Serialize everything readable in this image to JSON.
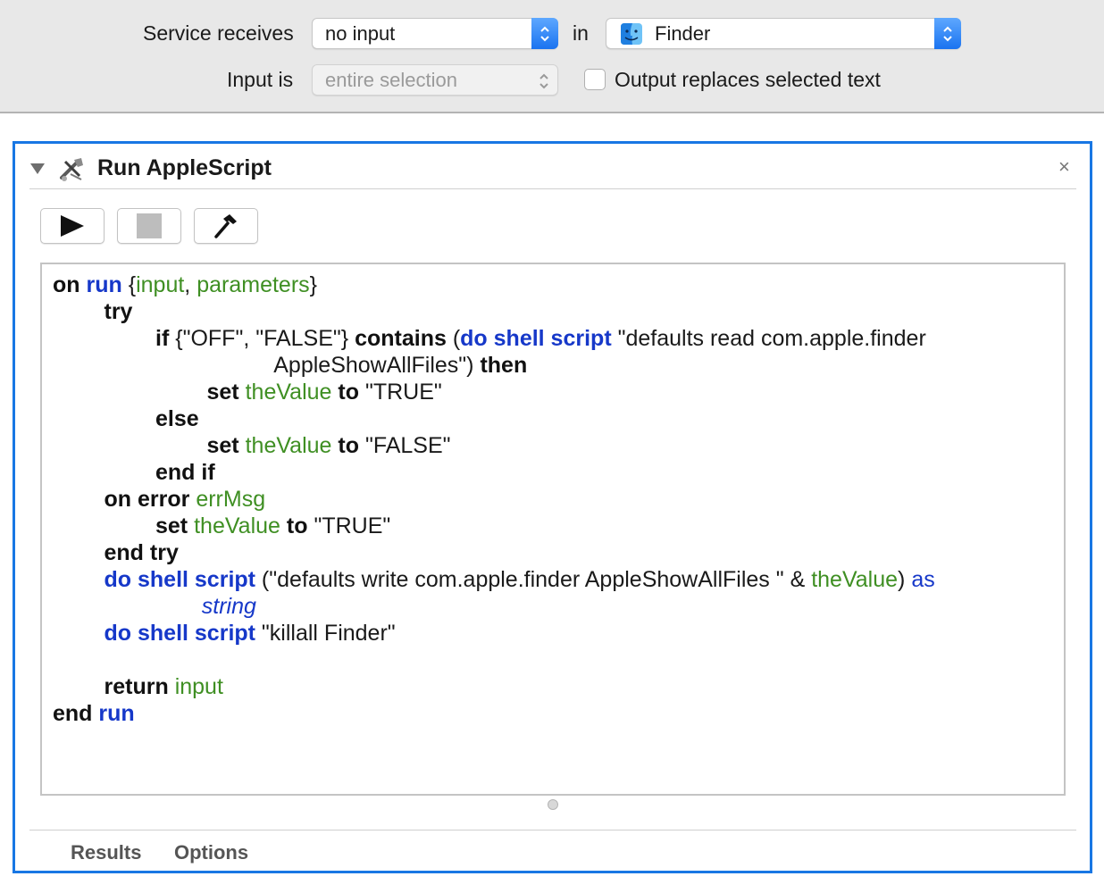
{
  "settings": {
    "service_receives_label": "Service receives",
    "service_receives_value": "no input",
    "in_label": "in",
    "application_value": "Finder",
    "input_is_label": "Input is",
    "input_is_value": "entire selection",
    "output_replaces_label": "Output replaces selected text",
    "output_replaces_checked": false
  },
  "action": {
    "title": "Run AppleScript",
    "close_symbol": "×",
    "toolbar": {
      "run_icon": "play-icon",
      "stop_icon": "stop-icon",
      "compile_icon": "hammer-icon"
    },
    "script_lines": [
      {
        "indent": 0,
        "tokens": [
          {
            "t": "on",
            "c": "kw"
          },
          {
            "t": " ",
            "c": ""
          },
          {
            "t": "run",
            "c": "cmd"
          },
          {
            "t": " {",
            "c": ""
          },
          {
            "t": "input",
            "c": "var"
          },
          {
            "t": ", ",
            "c": ""
          },
          {
            "t": "parameters",
            "c": "var"
          },
          {
            "t": "}",
            "c": ""
          }
        ]
      },
      {
        "indent": 1,
        "tokens": [
          {
            "t": "try",
            "c": "kw"
          }
        ]
      },
      {
        "indent": 2,
        "tokens": [
          {
            "t": "if",
            "c": "kw"
          },
          {
            "t": " {\"OFF\", \"FALSE\"} ",
            "c": ""
          },
          {
            "t": "contains",
            "c": "kw"
          },
          {
            "t": " (",
            "c": ""
          },
          {
            "t": "do shell script",
            "c": "cmd"
          },
          {
            "t": " \"defaults read com.apple.finder",
            "c": ""
          }
        ]
      },
      {
        "indent": 4.3,
        "tokens": [
          {
            "t": "AppleShowAllFiles\") ",
            "c": ""
          },
          {
            "t": "then",
            "c": "kw"
          }
        ]
      },
      {
        "indent": 3,
        "tokens": [
          {
            "t": "set",
            "c": "kw"
          },
          {
            "t": " ",
            "c": ""
          },
          {
            "t": "theValue",
            "c": "var"
          },
          {
            "t": " ",
            "c": ""
          },
          {
            "t": "to",
            "c": "kw"
          },
          {
            "t": " \"TRUE\"",
            "c": ""
          }
        ]
      },
      {
        "indent": 2,
        "tokens": [
          {
            "t": "else",
            "c": "kw"
          }
        ]
      },
      {
        "indent": 3,
        "tokens": [
          {
            "t": "set",
            "c": "kw"
          },
          {
            "t": " ",
            "c": ""
          },
          {
            "t": "theValue",
            "c": "var"
          },
          {
            "t": " ",
            "c": ""
          },
          {
            "t": "to",
            "c": "kw"
          },
          {
            "t": " \"FALSE\"",
            "c": ""
          }
        ]
      },
      {
        "indent": 2,
        "tokens": [
          {
            "t": "end if",
            "c": "kw"
          }
        ]
      },
      {
        "indent": 1,
        "tokens": [
          {
            "t": "on error",
            "c": "kw"
          },
          {
            "t": " ",
            "c": ""
          },
          {
            "t": "errMsg",
            "c": "var"
          }
        ]
      },
      {
        "indent": 2,
        "tokens": [
          {
            "t": "set",
            "c": "kw"
          },
          {
            "t": " ",
            "c": ""
          },
          {
            "t": "theValue",
            "c": "var"
          },
          {
            "t": " ",
            "c": ""
          },
          {
            "t": "to",
            "c": "kw"
          },
          {
            "t": " \"TRUE\"",
            "c": ""
          }
        ]
      },
      {
        "indent": 1,
        "tokens": [
          {
            "t": "end try",
            "c": "kw"
          }
        ]
      },
      {
        "indent": 1,
        "tokens": [
          {
            "t": "do shell script",
            "c": "cmd"
          },
          {
            "t": " (\"defaults write com.apple.finder AppleShowAllFiles \" & ",
            "c": ""
          },
          {
            "t": "theValue",
            "c": "var"
          },
          {
            "t": ") ",
            "c": ""
          },
          {
            "t": "as",
            "c": "term"
          }
        ]
      },
      {
        "indent": 2.9,
        "tokens": [
          {
            "t": "string",
            "c": "ital"
          }
        ]
      },
      {
        "indent": 1,
        "tokens": [
          {
            "t": "do shell script",
            "c": "cmd"
          },
          {
            "t": " \"killall Finder\"",
            "c": ""
          }
        ]
      },
      {
        "indent": 0,
        "tokens": []
      },
      {
        "indent": 1,
        "tokens": [
          {
            "t": "return",
            "c": "kw"
          },
          {
            "t": " ",
            "c": ""
          },
          {
            "t": "input",
            "c": "var"
          }
        ]
      },
      {
        "indent": 0,
        "tokens": [
          {
            "t": "end",
            "c": "kw"
          },
          {
            "t": " ",
            "c": ""
          },
          {
            "t": "run",
            "c": "cmd"
          }
        ]
      }
    ],
    "footer_tabs": [
      "Results",
      "Options"
    ]
  },
  "colors": {
    "accent": "#1877e4",
    "keyword": "#111111",
    "command": "#1638c9",
    "variable": "#3f8f23"
  }
}
